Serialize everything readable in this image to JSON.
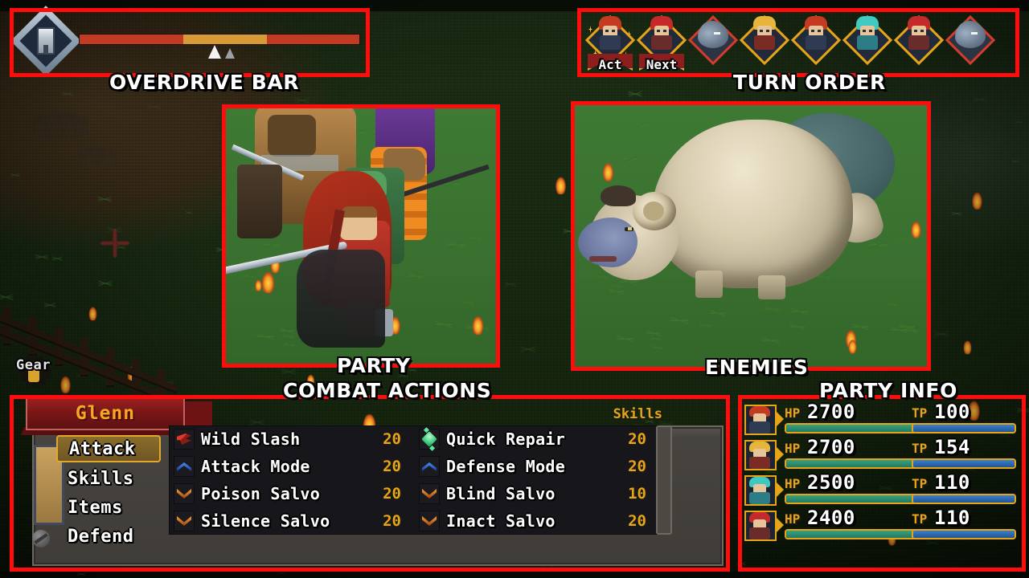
{
  "annotations": {
    "overdrive": "OVERDRIVE BAR",
    "turn_order": "TURN ORDER",
    "party": "PARTY",
    "enemies": "ENEMIES",
    "combat_actions": "COMBAT ACTIONS",
    "party_info": "PARTY INFO"
  },
  "colors": {
    "annotation_red": "#ff0d0d",
    "gold": "#e8a417",
    "hp_bar": "#2e8f74",
    "tp_bar": "#2c6ab0",
    "selection": "#8a6d2c",
    "banner_red": "#8a1a1a",
    "field_green": "#3a7030"
  },
  "overdrive": {
    "icon": "flask-diamond-icon",
    "segments": [
      {
        "name": "low",
        "color": "#c23a22",
        "pct": 37
      },
      {
        "name": "mid",
        "color": "#d89a36",
        "pct": 30
      },
      {
        "name": "high",
        "color": "#c23a22",
        "pct": 33
      }
    ],
    "markers": [
      {
        "name": "current-marker",
        "color": "#f2f2f2",
        "pos_pct": 46
      },
      {
        "name": "threshold-marker",
        "color": "#9aa0a6",
        "pos_pct": 52
      }
    ]
  },
  "turn_order": {
    "slots": [
      {
        "name": "glenn",
        "tag": "Act",
        "type": "ally",
        "hair": "#c43b22",
        "body": "#2e3b52",
        "active": true
      },
      {
        "name": "serai",
        "tag": "Next",
        "type": "ally",
        "hair": "#c42a2a",
        "body": "#6a2b2b",
        "active": false
      },
      {
        "name": "wolf-1",
        "tag": "",
        "type": "enemy",
        "hair": "",
        "body": "",
        "active": false
      },
      {
        "name": "kabbu",
        "tag": "",
        "type": "ally",
        "hair": "#e8b53c",
        "body": "#7a2b24",
        "active": false
      },
      {
        "name": "glenn-2",
        "tag": "",
        "type": "ally",
        "hair": "#c43b22",
        "body": "#2e3b52",
        "active": false
      },
      {
        "name": "triangle",
        "tag": "",
        "type": "ally",
        "hair": "#3fc9c0",
        "body": "#2d7d86",
        "active": false
      },
      {
        "name": "serai-2",
        "tag": "",
        "type": "ally",
        "hair": "#c42a2a",
        "body": "#6a2b2b",
        "active": false
      },
      {
        "name": "wolf-2",
        "tag": "",
        "type": "enemy",
        "hair": "",
        "body": "",
        "active": false
      }
    ]
  },
  "combat": {
    "character_name": "Glenn",
    "menu": [
      {
        "label": "Attack",
        "selected": true,
        "submenu": false,
        "submenu_dim": false
      },
      {
        "label": "Skills",
        "selected": false,
        "submenu": true,
        "submenu_dim": false
      },
      {
        "label": "Items",
        "selected": false,
        "submenu": true,
        "submenu_dim": true
      },
      {
        "label": "Defend",
        "selected": false,
        "submenu": false,
        "submenu_dim": false
      }
    ],
    "skills_header": "Skills",
    "skills": [
      {
        "name": "Wild Slash",
        "cost": "20",
        "icon": "red-slash-icon"
      },
      {
        "name": "Quick Repair",
        "cost": "20",
        "icon": "green-gem-icon"
      },
      {
        "name": "Attack Mode",
        "cost": "20",
        "icon": "blue-chevron-up-icon"
      },
      {
        "name": "Defense Mode",
        "cost": "20",
        "icon": "blue-chevron-up-icon"
      },
      {
        "name": "Poison Salvo",
        "cost": "20",
        "icon": "orange-chevron-down-icon"
      },
      {
        "name": "Blind Salvo",
        "cost": "10",
        "icon": "orange-chevron-down-icon"
      },
      {
        "name": "Silence Salvo",
        "cost": "20",
        "icon": "orange-chevron-down-icon"
      },
      {
        "name": "Inact Salvo",
        "cost": "20",
        "icon": "orange-chevron-down-icon"
      }
    ]
  },
  "party_info": {
    "hp_label": "HP",
    "tp_label": "TP",
    "members": [
      {
        "name": "glenn",
        "hp": "2700",
        "tp": "100",
        "hp_pct": 100,
        "tp_pct": 100,
        "hair": "#c43b22",
        "body": "#2e3b52"
      },
      {
        "name": "kabbu",
        "hp": "2700",
        "tp": "154",
        "hp_pct": 100,
        "tp_pct": 100,
        "hair": "#e8b53c",
        "body": "#7a2b24"
      },
      {
        "name": "triangle",
        "hp": "2500",
        "tp": "110",
        "hp_pct": 100,
        "tp_pct": 100,
        "hair": "#3fc9c0",
        "body": "#2d7d86"
      },
      {
        "name": "serai",
        "hp": "2400",
        "tp": "110",
        "hp_pct": 100,
        "tp_pct": 100,
        "hair": "#c42a2a",
        "body": "#6a2b2b"
      }
    ]
  },
  "world": {
    "gear_label": "Gear"
  }
}
